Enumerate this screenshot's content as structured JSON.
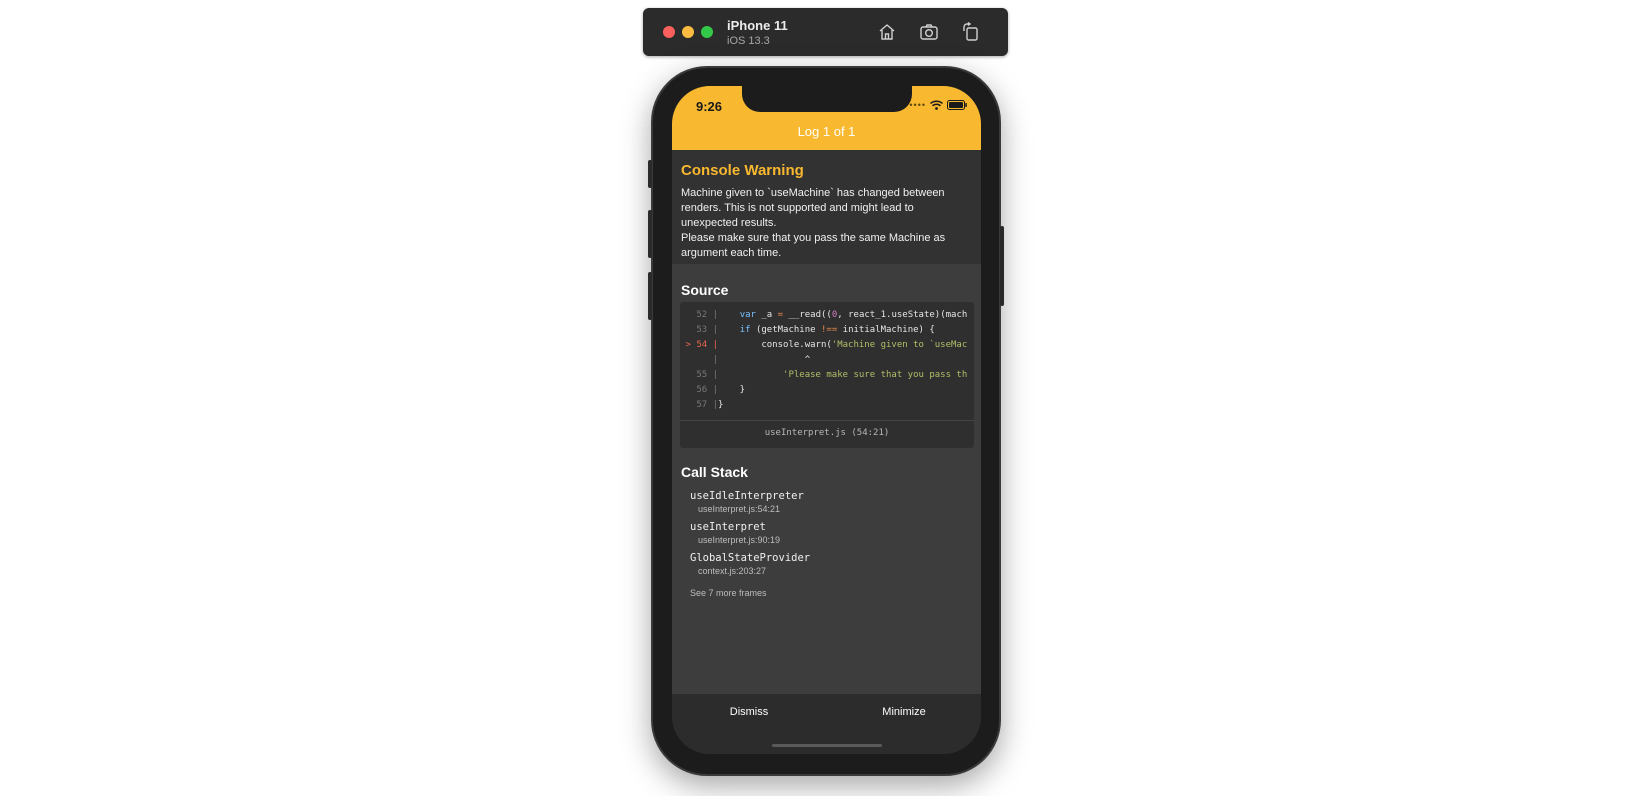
{
  "simulator": {
    "device_name": "iPhone 11",
    "os_version": "iOS 13.3",
    "toolbar": [
      "home-icon",
      "screenshot-icon",
      "rotate-icon"
    ]
  },
  "status_bar": {
    "time": "9:26",
    "signal_dots": "••••",
    "icons": [
      "wifi-icon",
      "battery-icon"
    ]
  },
  "header": {
    "title": "Log 1 of 1",
    "color": "#f8b82f"
  },
  "warning": {
    "title": "Console Warning",
    "message": "Machine given to `useMachine` has changed between renders. This is not supported and might lead to unexpected results.\nPlease make sure that you pass the same Machine as argument each time."
  },
  "source": {
    "title": "Source",
    "lines": [
      {
        "gutter": "52 |",
        "active": false,
        "code": "    var _a = __read((0, react_1.useState)(mach"
      },
      {
        "gutter": "53 |",
        "active": false,
        "code": "    if (getMachine !== initialMachine) {"
      },
      {
        "gutter": "> 54 |",
        "active": true,
        "code": "        console.warn('Machine given to `useMac"
      },
      {
        "gutter": "|",
        "active": false,
        "code": "                ^"
      },
      {
        "gutter": "55 |",
        "active": false,
        "code": "            'Please make sure that you pass th"
      },
      {
        "gutter": "56 |",
        "active": false,
        "code": "    }"
      },
      {
        "gutter": "57 |",
        "active": false,
        "code": "}"
      }
    ],
    "file_ref": "useInterpret.js (54:21)"
  },
  "call_stack": {
    "title": "Call Stack",
    "frames": [
      {
        "name": "useIdleInterpreter",
        "location": "useInterpret.js:54:21"
      },
      {
        "name": "useInterpret",
        "location": "useInterpret.js:90:19"
      },
      {
        "name": "GlobalStateProvider",
        "location": "context.js:203:27"
      }
    ],
    "more": "See 7 more frames"
  },
  "footer": {
    "dismiss": "Dismiss",
    "minimize": "Minimize"
  }
}
